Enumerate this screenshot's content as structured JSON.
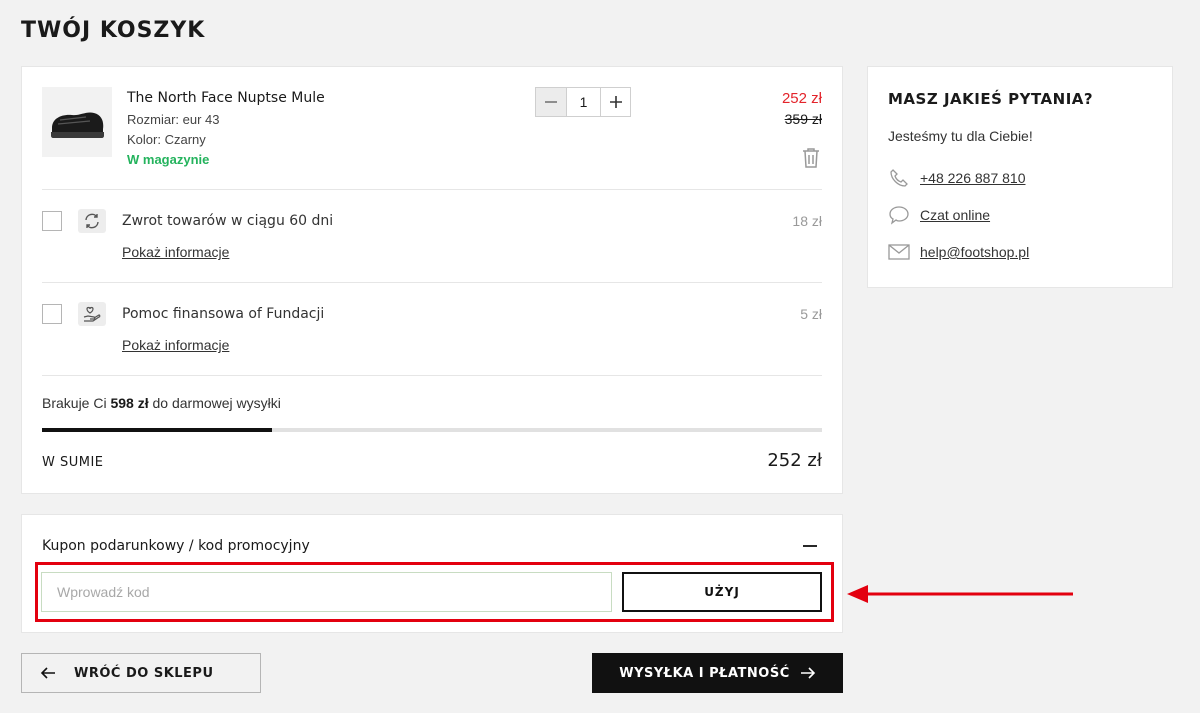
{
  "page": {
    "title": "TWÓJ KOSZYK"
  },
  "cart": {
    "item": {
      "name": "The North Face Nuptse Mule",
      "size": "Rozmiar: eur 43",
      "color": "Kolor: Czarny",
      "stock": "W magazynie",
      "quantity": "1",
      "price_current": "252 zł",
      "price_old": "359 zł"
    },
    "addons": [
      {
        "title": "Zwrot towarów w ciągu 60 dni",
        "link": "Pokaż informacje",
        "price": "18 zł",
        "icon": "return-arrows-icon"
      },
      {
        "title": "Pomoc finansowa of Fundacji",
        "link": "Pokaż informacje",
        "price": "5 zł",
        "icon": "heart-hand-icon"
      }
    ],
    "shipping": {
      "prefix": "Brakuje Ci",
      "amount": "598 zł",
      "suffix": "do darmowej wysyłki",
      "progress_fraction": 0.295
    },
    "total": {
      "label": "W SUMIE",
      "value": "252 zł"
    }
  },
  "coupon": {
    "title": "Kupon podarunkowy / kod promocyjny",
    "placeholder": "Wprowadź kod",
    "apply_label": "UŻYJ"
  },
  "nav": {
    "back_label": "WRÓĆ DO SKLEPU",
    "next_label": "WYSYŁKA I PŁATNOŚĆ"
  },
  "support": {
    "title": "MASZ JAKIEŚ PYTANIA?",
    "subtitle": "Jesteśmy tu dla Ciebie!",
    "phone": "+48 226 887 810",
    "chat": "Czat online",
    "email": "help@footshop.pl"
  },
  "colors": {
    "accent_red": "#e3242b",
    "stock_green": "#24b35d",
    "primary_dark": "#111111",
    "annotation_red": "#e3000f"
  }
}
